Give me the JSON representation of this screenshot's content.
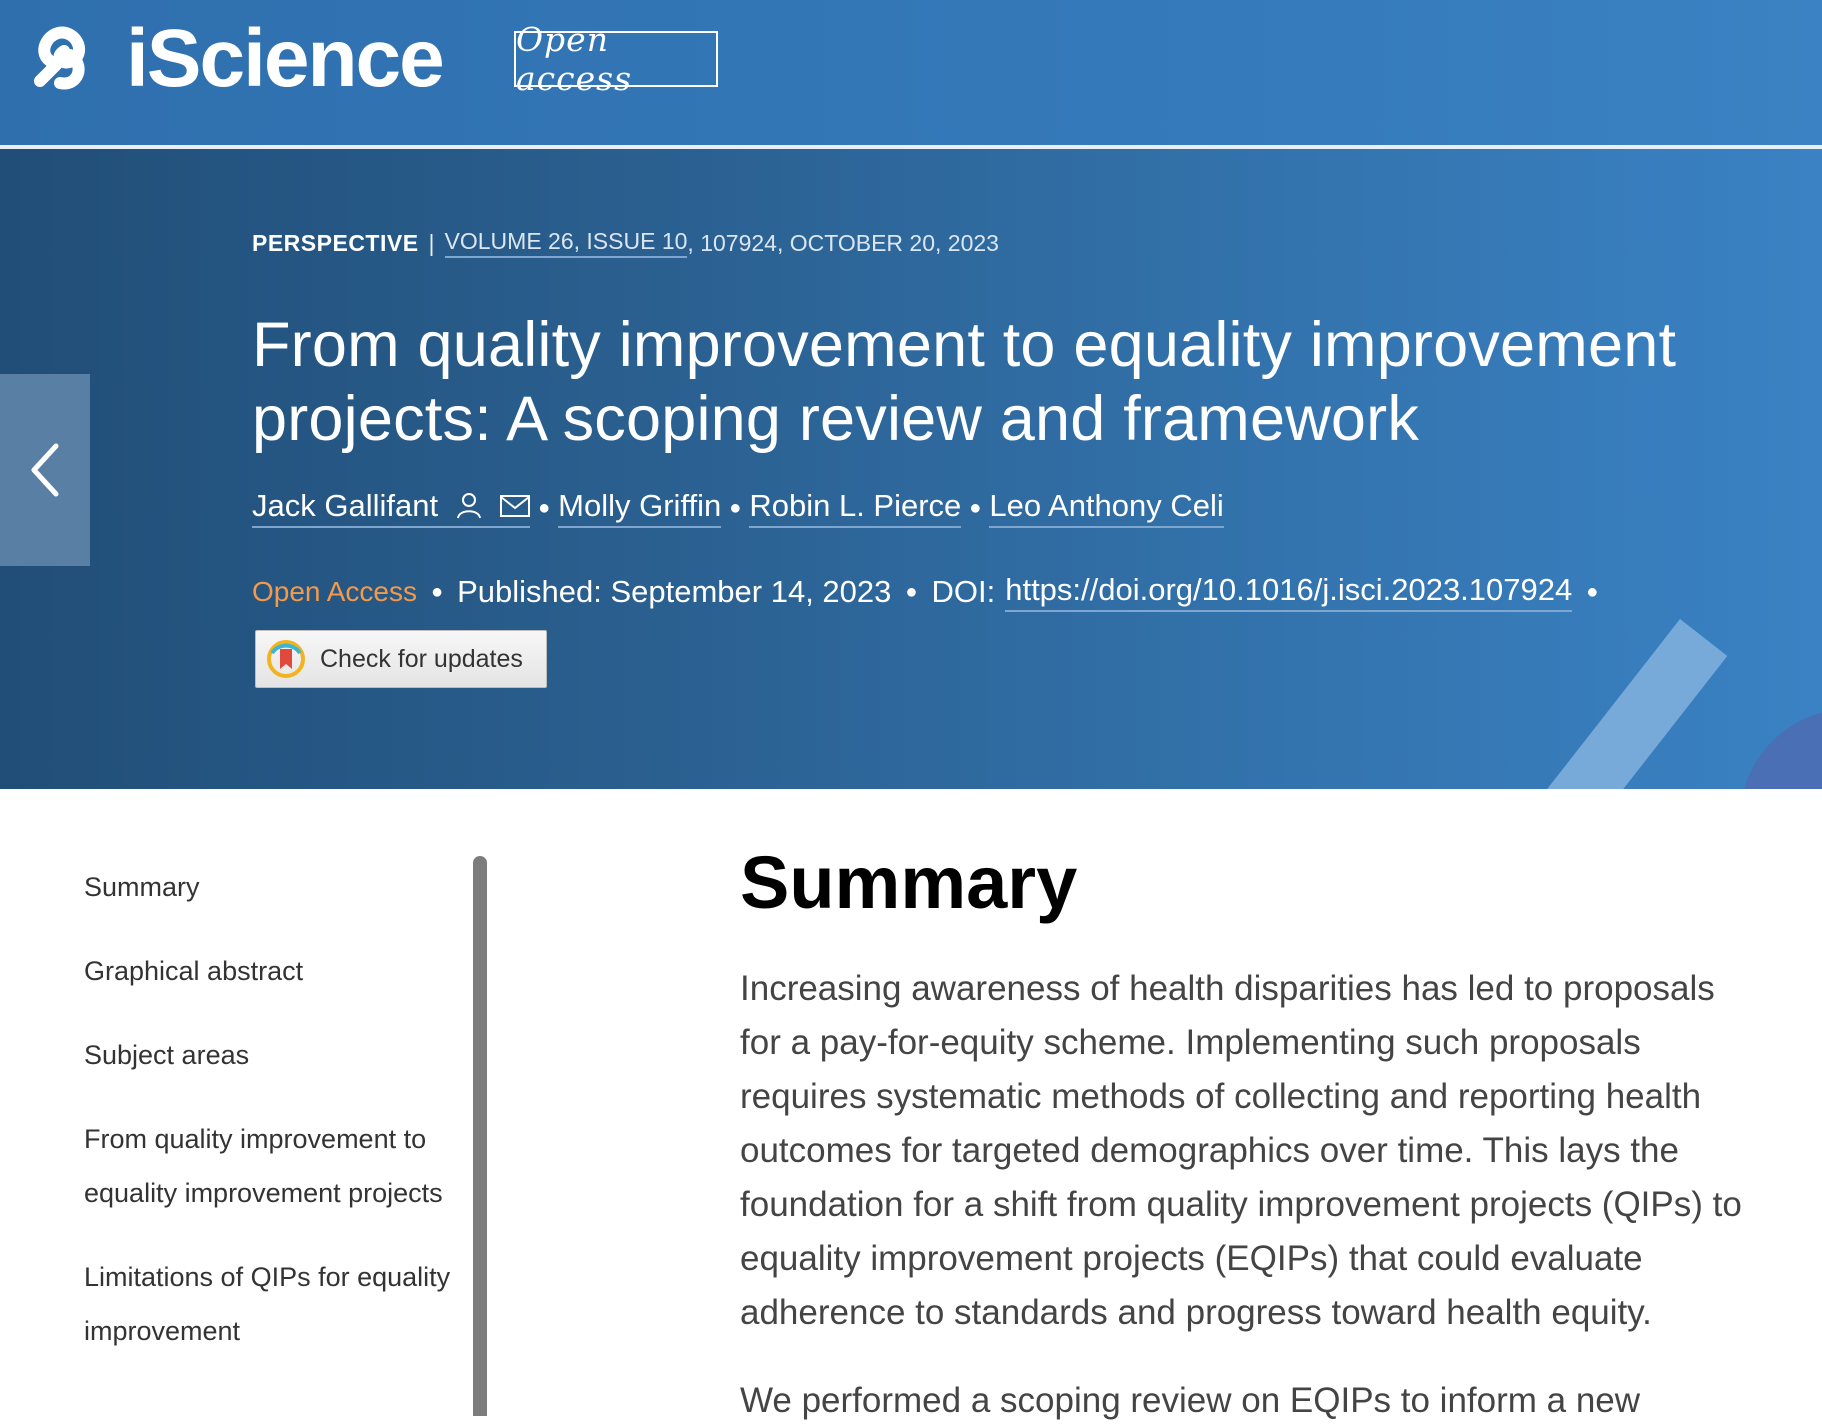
{
  "header": {
    "journal_name": "iScience",
    "open_access_badge": "Open access"
  },
  "article": {
    "type": "PERSPECTIVE",
    "separator": "|",
    "volume_issue": "VOLUME 26, ISSUE 10",
    "meta_rest": ", 107924, OCTOBER 20, 2023",
    "title": "From quality improvement to equality improvement projects: A scoping review and framework",
    "authors": [
      {
        "name": "Jack Gallifant"
      },
      {
        "name": "Molly Griffin"
      },
      {
        "name": "Robin L. Pierce"
      },
      {
        "name": "Leo Anthony Celi"
      }
    ],
    "open_access": "Open Access",
    "published": "Published: September 14, 2023",
    "doi_label": "DOI:",
    "doi_url": "https://doi.org/10.1016/j.isci.2023.107924",
    "check_updates": "Check for updates"
  },
  "toc": {
    "items": [
      {
        "label": "Summary"
      },
      {
        "label": "Graphical abstract"
      },
      {
        "label": "Subject areas"
      },
      {
        "label": "From quality improvement to equality improvement projects"
      },
      {
        "label": "Limitations of QIPs for equality improvement"
      }
    ]
  },
  "main": {
    "heading": "Summary",
    "paragraph1": "Increasing awareness of health disparities has led to proposals for a pay-for-equity scheme. Implementing such proposals requires systematic methods of collecting and reporting health outcomes for targeted demographics over time. This lays the foundation for a shift from quality improvement projects (QIPs) to equality improvement projects (EQIPs) that could evaluate adherence to standards and progress toward health equity.",
    "paragraph2": "We performed a scoping review on EQIPs to inform a new"
  },
  "colors": {
    "header_blue": "#3479b9",
    "hero_dark": "#214e78",
    "open_access_orange": "#f39a4a"
  },
  "icons": [
    "iscience-logo-icon",
    "back-chevron-icon",
    "person-icon",
    "envelope-icon",
    "crossmark-icon"
  ]
}
